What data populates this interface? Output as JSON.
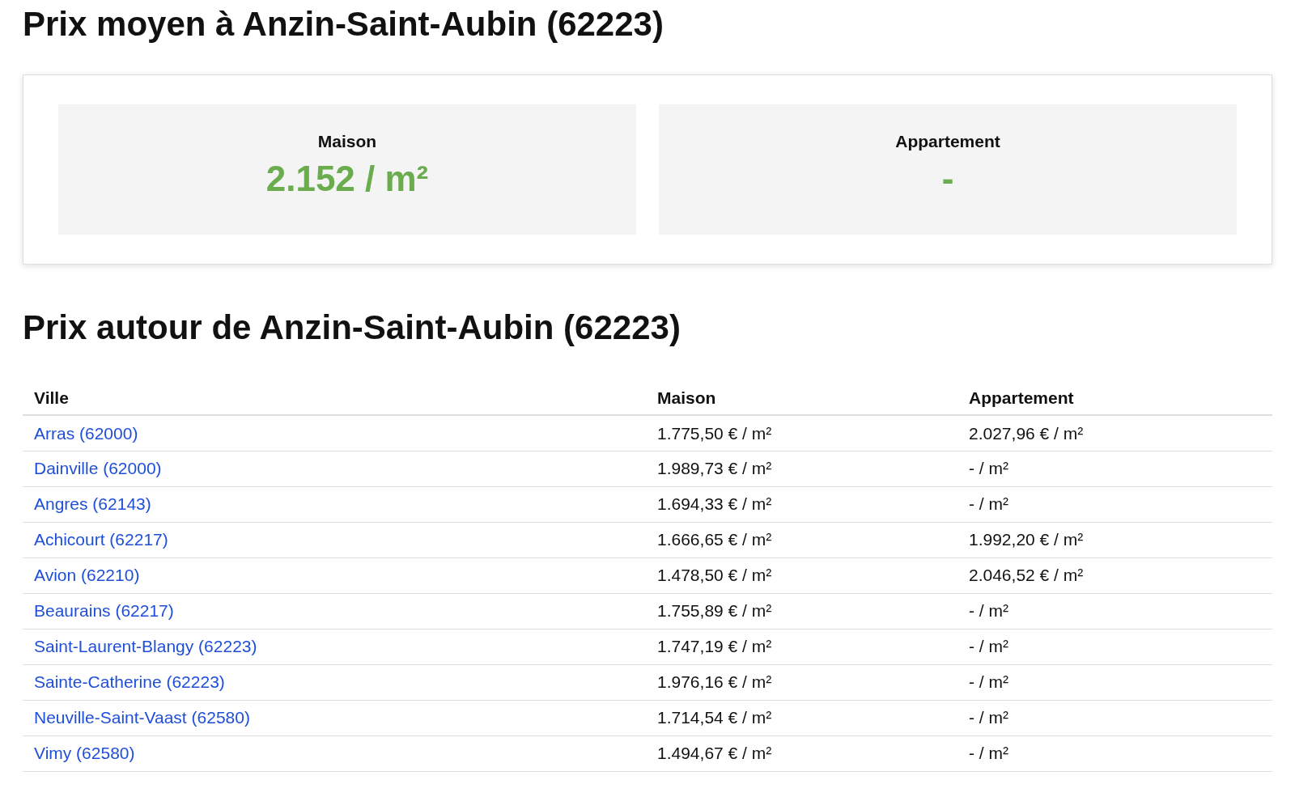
{
  "title": "Prix moyen à Anzin-Saint-Aubin (62223)",
  "summary": [
    {
      "label": "Maison",
      "value": "2.152 / m²"
    },
    {
      "label": "Appartement",
      "value": "-"
    }
  ],
  "nearby_title": "Prix autour de Anzin-Saint-Aubin (62223)",
  "table": {
    "columns": [
      "Ville",
      "Maison",
      "Appartement"
    ],
    "rows": [
      [
        "Arras (62000)",
        "1.775,50 € / m²",
        "2.027,96 € / m²"
      ],
      [
        "Dainville (62000)",
        "1.989,73 € / m²",
        "- / m²"
      ],
      [
        "Angres (62143)",
        "1.694,33 € / m²",
        "- / m²"
      ],
      [
        "Achicourt (62217)",
        "1.666,65 € / m²",
        "1.992,20 € / m²"
      ],
      [
        "Avion (62210)",
        "1.478,50 € / m²",
        "2.046,52 € / m²"
      ],
      [
        "Beaurains (62217)",
        "1.755,89 € / m²",
        "- / m²"
      ],
      [
        "Saint-Laurent-Blangy (62223)",
        "1.747,19 € / m²",
        "- / m²"
      ],
      [
        "Sainte-Catherine (62223)",
        "1.976,16 € / m²",
        "- / m²"
      ],
      [
        "Neuville-Saint-Vaast (62580)",
        "1.714,54 € / m²",
        "- / m²"
      ],
      [
        "Vimy (62580)",
        "1.494,67 € / m²",
        "- / m²"
      ]
    ]
  }
}
